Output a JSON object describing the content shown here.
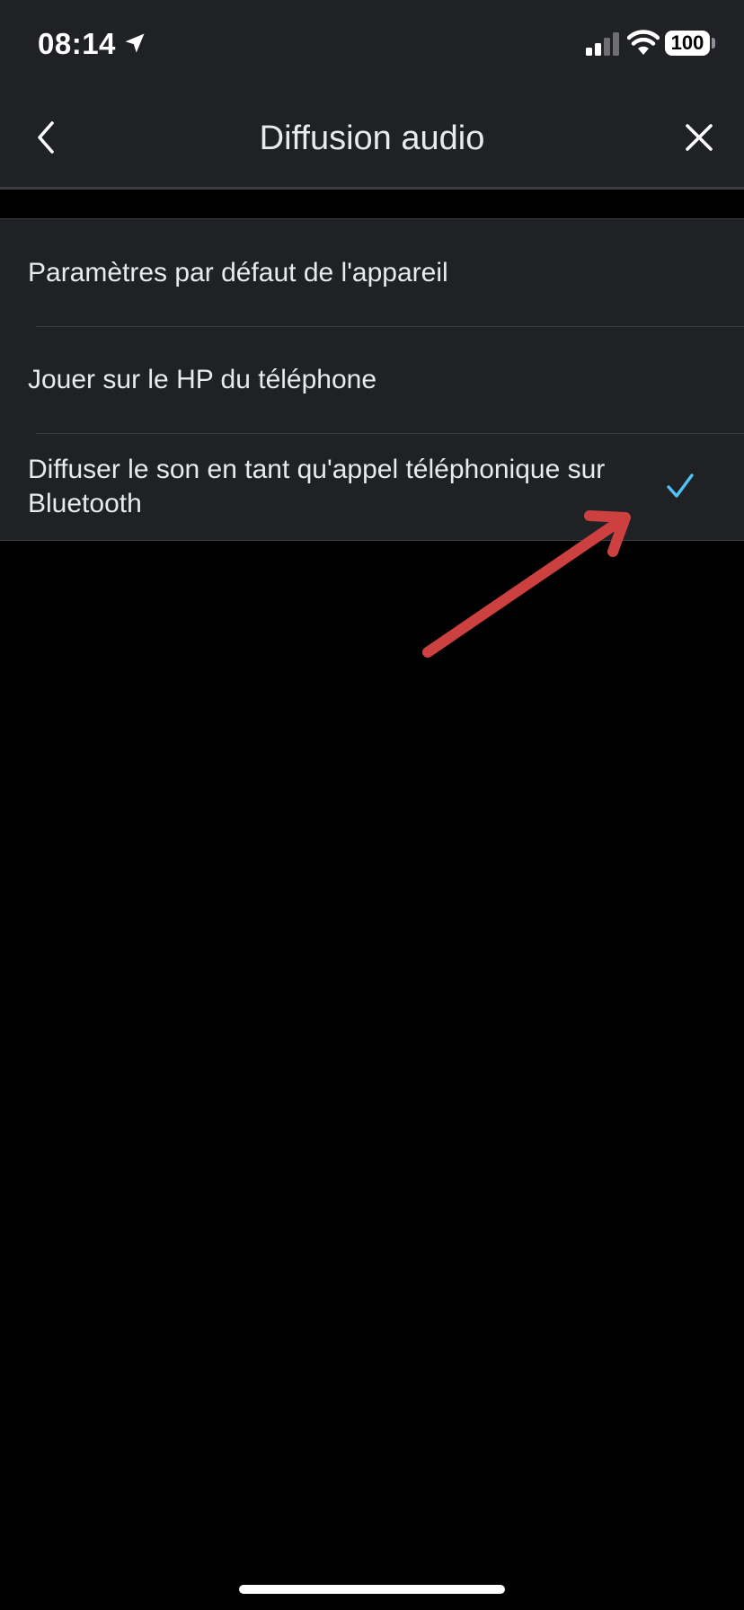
{
  "status_bar": {
    "time": "08:14",
    "battery_level": "100",
    "icons": [
      "location-arrow-icon",
      "cellular-signal-icon",
      "wifi-icon",
      "battery-icon"
    ]
  },
  "nav": {
    "title": "Diffusion audio",
    "back_icon": "chevron-left-icon",
    "close_icon": "close-icon"
  },
  "options": [
    {
      "label": "Paramètres par défaut de l'appareil",
      "selected": false
    },
    {
      "label": "Jouer sur le HP du téléphone",
      "selected": false
    },
    {
      "label": "Diffuser le son en tant qu'appel téléphonique sur Bluetooth",
      "selected": true
    }
  ],
  "colors": {
    "background": "#000000",
    "surface": "#202124",
    "divider": "#3c3d40",
    "text": "#e8eaed",
    "check": "#4fc3f7",
    "annotation_arrow": "#cc4040"
  }
}
